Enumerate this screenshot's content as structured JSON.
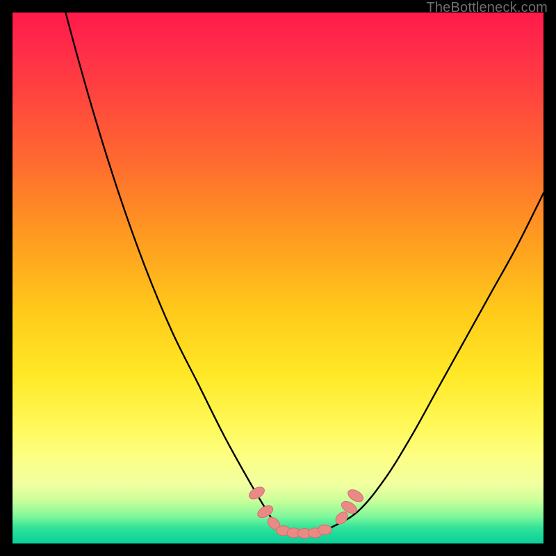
{
  "watermark": {
    "text": "TheBottleneck.com"
  },
  "colors": {
    "curve": "#000000",
    "marker_fill": "#e98a86",
    "marker_stroke": "#d66e6a"
  },
  "chart_data": {
    "type": "line",
    "title": "",
    "xlabel": "",
    "ylabel": "",
    "xlim": [
      0,
      100
    ],
    "ylim": [
      0,
      100
    ],
    "grid": false,
    "series": [
      {
        "name": "bottleneck-curve",
        "x": [
          0,
          5,
          10,
          15,
          20,
          25,
          30,
          35,
          40,
          45,
          48,
          50,
          52,
          55,
          58,
          60,
          65,
          70,
          75,
          80,
          85,
          90,
          95,
          100
        ],
        "y": [
          145,
          120,
          100,
          82,
          66,
          52,
          40,
          30,
          20,
          11,
          6,
          3,
          2,
          2,
          2,
          3,
          6,
          12,
          20,
          29,
          38,
          47,
          56,
          66
        ]
      }
    ],
    "markers": [
      {
        "x": 46.0,
        "y": 9.5
      },
      {
        "x": 47.6,
        "y": 6.0
      },
      {
        "x": 49.2,
        "y": 3.8
      },
      {
        "x": 51.0,
        "y": 2.4
      },
      {
        "x": 53.0,
        "y": 2.0
      },
      {
        "x": 55.0,
        "y": 1.9
      },
      {
        "x": 57.0,
        "y": 2.0
      },
      {
        "x": 58.8,
        "y": 2.6
      },
      {
        "x": 62.0,
        "y": 4.8
      },
      {
        "x": 63.4,
        "y": 6.8
      },
      {
        "x": 64.6,
        "y": 9.0
      }
    ]
  }
}
